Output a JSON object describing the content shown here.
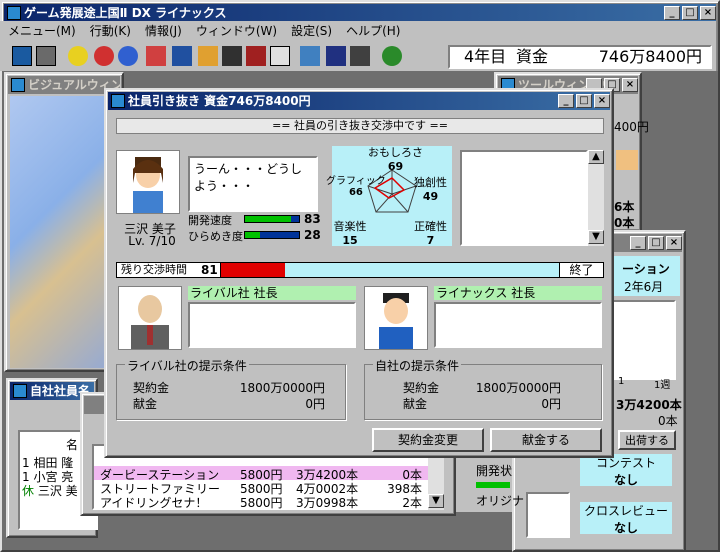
{
  "app": {
    "title": "ゲーム発展途上国Ⅱ DX ライナックス"
  },
  "menu": [
    "メニュー(M)",
    "行動(K)",
    "情報(J)",
    "ウィンドウ(W)",
    "設定(S)",
    "ヘルプ(H)"
  ],
  "status": {
    "year": "4年目",
    "funds_label": "資金",
    "funds": "746万8400円"
  },
  "visual": {
    "title": "ビジュアルウィンドウ"
  },
  "tool": {
    "title": "ツールウィンドウ",
    "partial_funds": "400円",
    "partial_count1": "6本",
    "partial_count2": "0本"
  },
  "side": {
    "line1": "ーション",
    "line2": "2年6月",
    "axis_left": "1",
    "axis_right": "1週",
    "count": "3万4200本",
    "count2": "0本",
    "ship_label": "出荷する",
    "contest_label": "コンテスト",
    "contest_val": "なし",
    "cross_label": "クロスレビュー",
    "cross_val": "なし"
  },
  "staffwin": {
    "title": "自社社員名",
    "col_name": "名",
    "rows": [
      {
        "n": "1",
        "name": "相田 隆"
      },
      {
        "n": "1",
        "name": "小宮 亮"
      },
      {
        "n": "休",
        "name": "三沢 美"
      }
    ]
  },
  "salesnote": {
    "dev_label": "開発状",
    "orig_label": "オリジナ"
  },
  "sales": {
    "rows": [
      {
        "name": "ダービーステーション",
        "price": "5800円",
        "sold": "3万4200本",
        "stock": "0本"
      },
      {
        "name": "ストリートファミリー",
        "price": "5800円",
        "sold": "4万0002本",
        "stock": "398本"
      },
      {
        "name": "アイドリングセナ！",
        "price": "5800円",
        "sold": "3万0998本",
        "stock": "2本"
      }
    ]
  },
  "dialog": {
    "title": "社員引き抜き 資金746万8400円",
    "banner": "== 社員の引き抜き交渉中です ==",
    "speech": "うーん・・・どうしよう・・・",
    "candidate": {
      "name": "三沢 美子",
      "level": "Lv. 7/10"
    },
    "stats": [
      {
        "label": "開発速度",
        "value": "83"
      },
      {
        "label": "ひらめき度",
        "value": "28"
      }
    ],
    "radar": [
      {
        "label": "おもしろさ",
        "value": "69"
      },
      {
        "label": "独創性",
        "value": "49"
      },
      {
        "label": "正確性",
        "value": "7"
      },
      {
        "label": "音楽性",
        "value": "15"
      },
      {
        "label": "グラフィック",
        "value": "66"
      }
    ],
    "time": {
      "label": "残り交渉時間",
      "value": "81",
      "end": "終了"
    },
    "rival": {
      "label": "ライバル社 社長",
      "cond_title": "ライバル社の提示条件",
      "contract_label": "契約金",
      "contract": "1800万0000円",
      "gift_label": "献金",
      "gift": "0円"
    },
    "own": {
      "label": "ライナックス 社長",
      "cond_title": "自社の提示条件",
      "contract_label": "契約金",
      "contract": "1800万0000円",
      "gift_label": "献金",
      "gift": "0円"
    },
    "buttons": {
      "change": "契約金変更",
      "donate": "献金する"
    }
  }
}
